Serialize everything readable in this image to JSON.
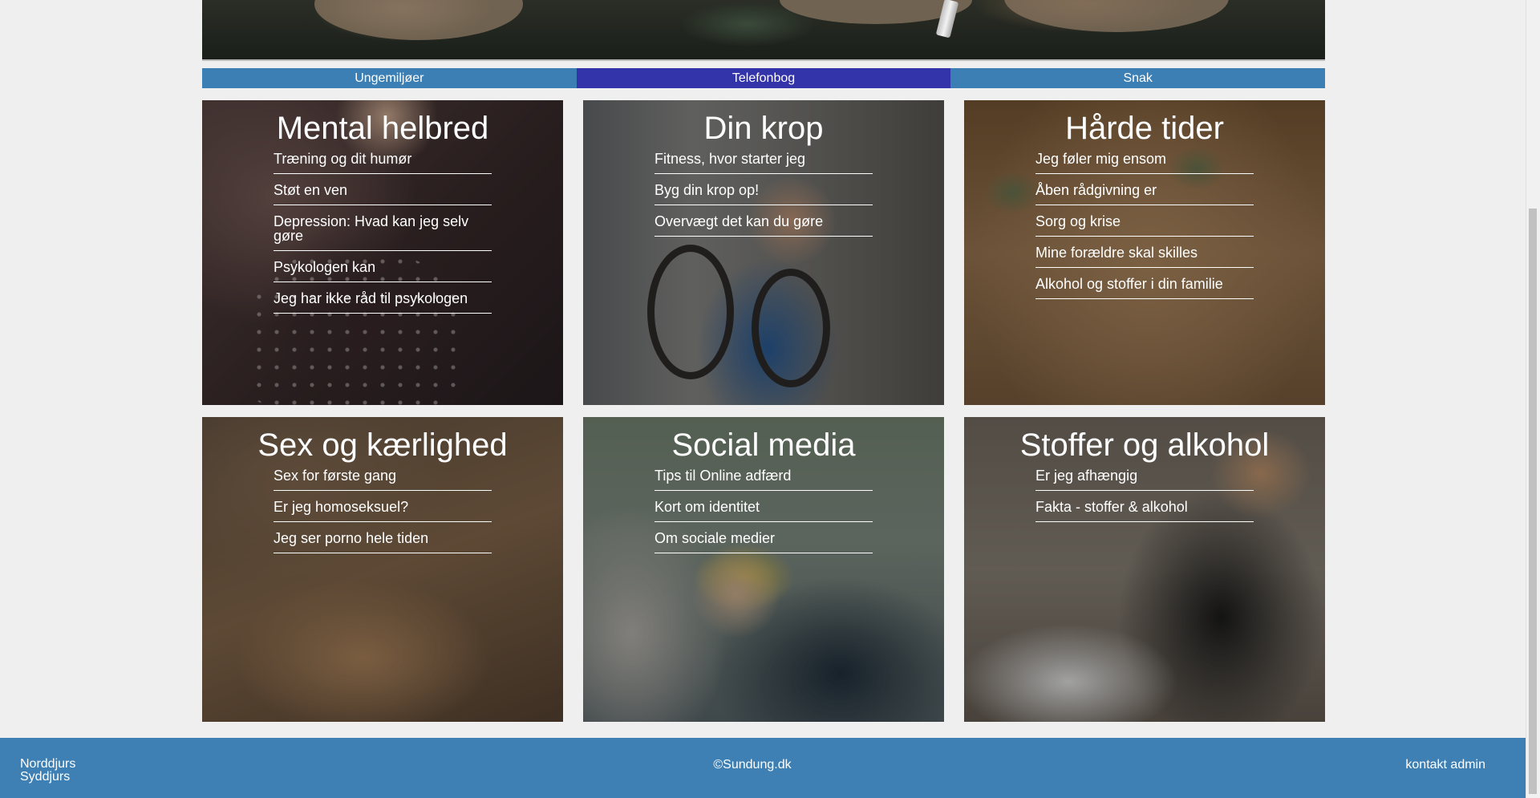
{
  "nav": {
    "items": [
      {
        "label": "Ungemiljøer",
        "active": false
      },
      {
        "label": "Telefonbog",
        "active": true
      },
      {
        "label": "Snak",
        "active": false
      }
    ]
  },
  "tiles": [
    {
      "title": "Mental helbred",
      "links": [
        "Træning og dit humør",
        "Støt en ven",
        "Depression: Hvad kan jeg selv gøre",
        "Psykologen kan",
        "Jeg har ikke råd til psykologen"
      ]
    },
    {
      "title": "Din krop",
      "links": [
        "Fitness, hvor starter jeg",
        "Byg din krop op!",
        "Overvægt det kan du gøre"
      ]
    },
    {
      "title": "Hårde tider",
      "links": [
        "Jeg føler mig ensom",
        "Åben rådgivning er",
        "Sorg og krise",
        "Mine forældre skal skilles",
        "Alkohol og stoffer i din familie"
      ]
    },
    {
      "title": "Sex og kærlighed",
      "links": [
        "Sex for første gang",
        "Er jeg homoseksuel?",
        "Jeg ser porno hele tiden"
      ]
    },
    {
      "title": "Social media",
      "links": [
        "Tips til Online adfærd",
        "Kort om identitet",
        "Om sociale medier"
      ]
    },
    {
      "title": "Stoffer og alkohol",
      "links": [
        "Er jeg afhængig",
        "Fakta - stoffer & alkohol"
      ]
    }
  ],
  "footer": {
    "left_line1": "Norddjurs",
    "left_line2": "Syddjurs",
    "center": "©Sundung.dk",
    "right": "kontakt admin"
  },
  "colors": {
    "nav_bg": "#3b7fb4",
    "nav_active_bg": "#3333aa",
    "footer_bg": "#3e80b4",
    "page_bg": "#efefef"
  }
}
